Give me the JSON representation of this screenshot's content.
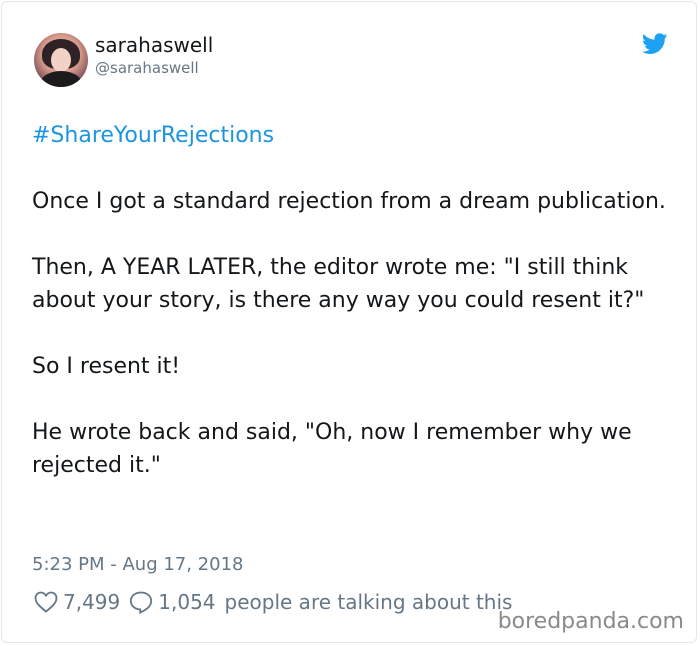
{
  "tweet": {
    "display_name": "sarahaswell",
    "handle": "@sarahaswell",
    "hashtag": "#ShareYourRejections",
    "paragraphs": [
      "Once I got a standard rejection from a dream publication.",
      "Then, A YEAR LATER, the editor wrote me: \"I still think about your story, is there any way you could resent it?\"",
      "So I resent it!",
      "He wrote back and said, \"Oh, now I remember why we rejected it.\""
    ],
    "timestamp": "5:23 PM - Aug 17, 2018",
    "likes": "7,499",
    "replies": "1,054",
    "talking_text": "people are talking about this"
  },
  "watermark": "boredpanda.com",
  "icons": {
    "brand": "twitter-bird-icon",
    "like": "heart-icon",
    "reply": "speech-bubble-icon"
  },
  "colors": {
    "hashtag": "#1b95e0",
    "bird": "#1da1f2",
    "muted": "#657786"
  }
}
